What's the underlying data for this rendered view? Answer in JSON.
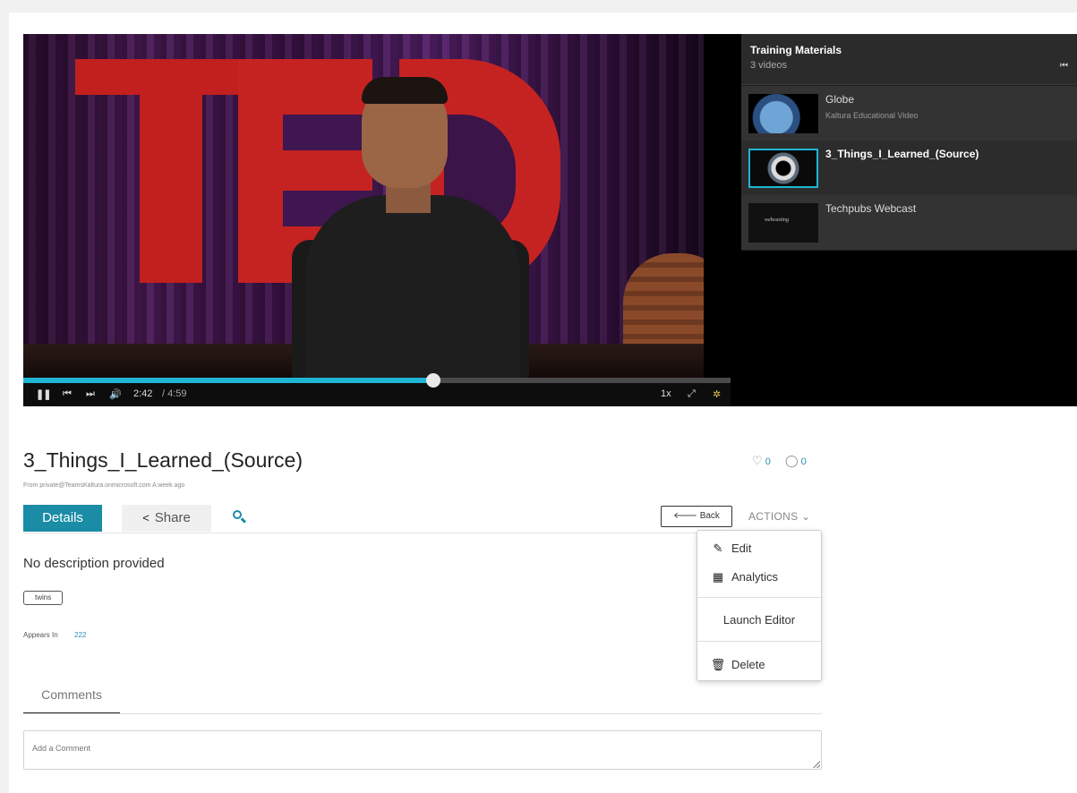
{
  "player": {
    "controls": {
      "pause_icon": "pause-icon",
      "prev_icon": "skip-back-icon",
      "next_icon": "skip-forward-icon",
      "volume_icon": "volume-icon",
      "time_current": "2:42",
      "time_total": "/ 4:59",
      "speed": "1x",
      "progress": 0.58
    },
    "playlist": {
      "title": "Training Materials",
      "count": "3 videos",
      "items": [
        {
          "name": "Globe",
          "sub": "Kaltura Educational Video"
        },
        {
          "name": "3_Things_I_Learned_(Source)",
          "sub": ""
        },
        {
          "name": "Techpubs Webcast",
          "sub": "",
          "thumb_text": "webcasting"
        }
      ]
    }
  },
  "entry": {
    "title": "3_Things_I_Learned_(Source)",
    "meta": "From private@TeamsKaltura.onmicrosoft.com A week ago",
    "likes": "0",
    "comments_count": "0",
    "description": "No description provided",
    "tags": [
      "twins"
    ],
    "appears_in_label": "Appears In",
    "appears_in_count": "222"
  },
  "tabs": {
    "details": "Details",
    "share": "Share"
  },
  "actions": {
    "back_label": "Back",
    "actions_label": "ACTIONS",
    "menu": {
      "edit": "Edit",
      "analytics": "Analytics",
      "launch_editor": "Launch Editor",
      "delete": "Delete"
    }
  },
  "comments": {
    "tab_label": "Comments",
    "placeholder": "Add a Comment"
  },
  "colors": {
    "accent": "#1a8ca6",
    "progress": "#1fb6d6",
    "link": "#2a90b0"
  }
}
